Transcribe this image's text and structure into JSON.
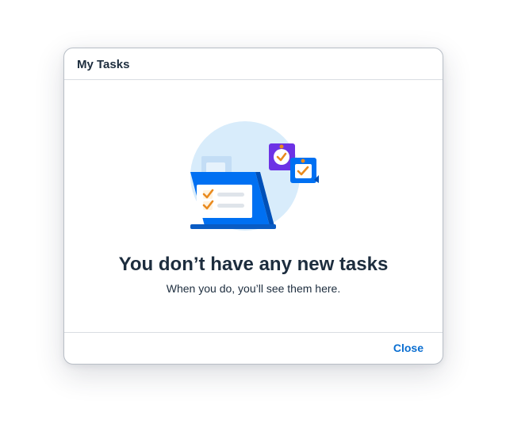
{
  "dialog": {
    "title": "My Tasks",
    "empty_state": {
      "illustration": "laptop-with-task-checklist-icon",
      "title": "You don’t have any new tasks",
      "subtitle": "When you do, you’ll see them here."
    },
    "footer": {
      "close_label": "Close"
    }
  },
  "colors": {
    "text": "#1d2d3e",
    "link": "#0a6ed1",
    "illustration_circle": "#d8ecfb",
    "laptop_blue": "#0070f2",
    "badge_purple": "#6c32e5",
    "check_orange": "#e98a1e"
  }
}
